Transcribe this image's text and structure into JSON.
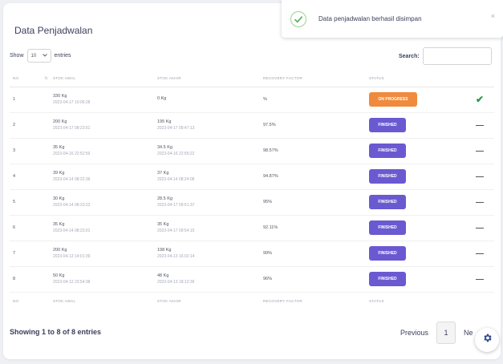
{
  "card": {
    "title": "Data Penjadwalan"
  },
  "length_menu": {
    "show": "Show",
    "value": "10",
    "entries": "entries"
  },
  "search": {
    "label": "Search:",
    "value": ""
  },
  "columns": [
    "NO",
    "STOK AWAL",
    "STOK AKHIR",
    "RECOVERY FACTOR",
    "STATUS",
    ""
  ],
  "rows": [
    {
      "no": "1",
      "awal_w": "330 Kg",
      "awal_t": "2023-04-17 10:06:28",
      "akhir_w": "0 Kg",
      "akhir_t": "",
      "recovery": "%",
      "status": "ON PROGRESS",
      "action": "check"
    },
    {
      "no": "2",
      "awal_w": "200 Kg",
      "awal_t": "2023-04-17 08:23:51",
      "akhir_w": "195 Kg",
      "akhir_t": "2023-04-17 09:47:13",
      "recovery": "97.5%",
      "status": "FINISHED",
      "action": "dash"
    },
    {
      "no": "3",
      "awal_w": "35 Kg",
      "awal_t": "2023-04-16 22:52:59",
      "akhir_w": "34.5 Kg",
      "akhir_t": "2023-04-16 22:55:22",
      "recovery": "98.57%",
      "status": "FINISHED",
      "action": "dash"
    },
    {
      "no": "4",
      "awal_w": "39 Kg",
      "awal_t": "2023-04-14 08:22:36",
      "akhir_w": "37 Kg",
      "akhir_t": "2023-04-14 08:24:08",
      "recovery": "94.87%",
      "status": "FINISHED",
      "action": "dash"
    },
    {
      "no": "5",
      "awal_w": "30 Kg",
      "awal_t": "2023-04-14 08:23:22",
      "akhir_w": "28.5 Kg",
      "akhir_t": "2023-04-17 09:51:37",
      "recovery": "95%",
      "status": "FINISHED",
      "action": "dash"
    },
    {
      "no": "6",
      "awal_w": "35 Kg",
      "awal_t": "2023-04-14 08:23:01",
      "akhir_w": "35 Kg",
      "akhir_t": "2023-04-17 09:54:15",
      "recovery": "92.11%",
      "status": "FINISHED",
      "action": "dash"
    },
    {
      "no": "7",
      "awal_w": "200 Kg",
      "awal_t": "2023-04-13 14:01:39",
      "akhir_w": "198 Kg",
      "akhir_t": "2023-04-13 16:02:14",
      "recovery": "99%",
      "status": "FINISHED",
      "action": "dash"
    },
    {
      "no": "8",
      "awal_w": "50 Kg",
      "awal_t": "2023-04-12 23:54:38",
      "akhir_w": "48 Kg",
      "akhir_t": "2023-04-13 18:12:39",
      "recovery": "96%",
      "status": "FINISHED",
      "action": "dash"
    }
  ],
  "footer": {
    "info": "Showing 1 to 8 of 8 entries",
    "previous": "Previous",
    "page": "1",
    "next": "Ne"
  },
  "toast": {
    "message": "Data penjadwalan berhasil disimpan",
    "close": "×"
  },
  "colors": {
    "finished": "#6a5ad1",
    "on_progress": "#f08a3c",
    "success": "#2b9a47"
  },
  "icons": {
    "toast": "check-circle-icon",
    "settings": "gear-icon",
    "row_check": "check-icon",
    "row_dash": "minus-icon"
  }
}
